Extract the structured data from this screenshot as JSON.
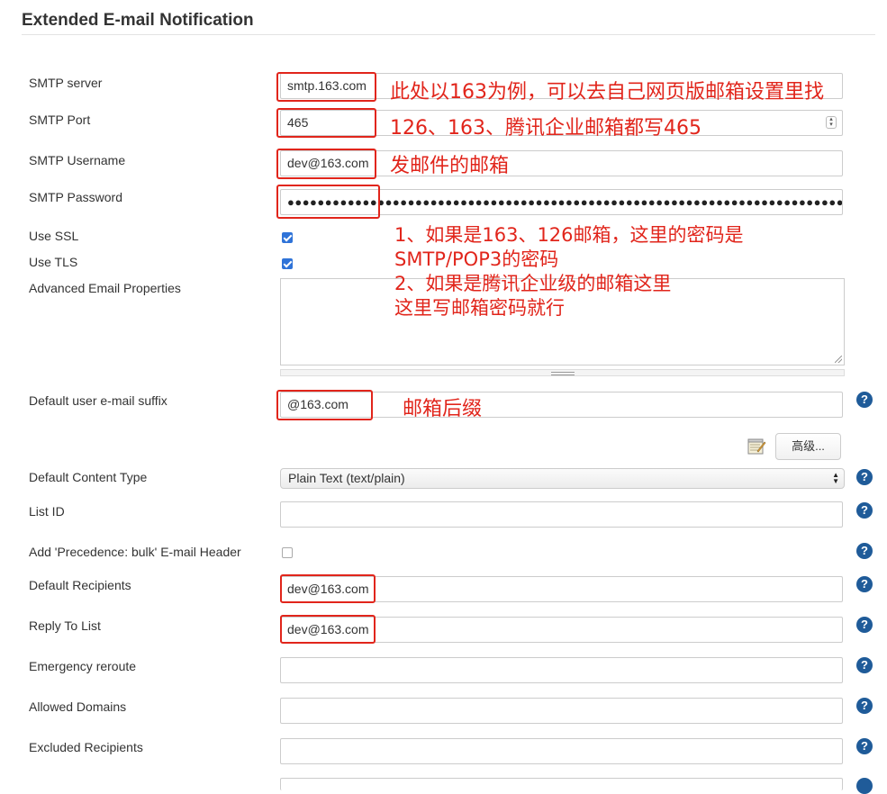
{
  "section": {
    "title": "Extended E-mail Notification"
  },
  "fields": {
    "smtp_server": {
      "label": "SMTP server",
      "value": "smtp.163.com"
    },
    "smtp_port": {
      "label": "SMTP Port",
      "value": "465"
    },
    "smtp_username": {
      "label": "SMTP Username",
      "value": "dev@163.com"
    },
    "smtp_password": {
      "label": "SMTP Password",
      "value": "●●●●●●●●●●●●●●●●●●●●●●●●●●●●●●●●●●●●●●●●●●●●●●●●●●●●●●●●●●●●●●●●●●●●●●●●●●●●●●●●●"
    },
    "use_ssl": {
      "label": "Use SSL",
      "checked": true
    },
    "use_tls": {
      "label": "Use TLS",
      "checked": true
    },
    "advanced_email_properties": {
      "label": "Advanced Email Properties",
      "value": ""
    },
    "default_user_suffix": {
      "label": "Default user e-mail suffix",
      "value": "@163.com"
    },
    "default_content_type": {
      "label": "Default Content Type",
      "value": "Plain Text (text/plain)"
    },
    "list_id": {
      "label": "List ID",
      "value": ""
    },
    "precedence_bulk": {
      "label": "Add 'Precedence: bulk' E-mail Header",
      "checked": false
    },
    "default_recipients": {
      "label": "Default Recipients",
      "value": "dev@163.com"
    },
    "reply_to_list": {
      "label": "Reply To List",
      "value": "dev@163.com"
    },
    "emergency_reroute": {
      "label": "Emergency reroute",
      "value": ""
    },
    "allowed_domains": {
      "label": "Allowed Domains",
      "value": ""
    },
    "excluded_recipients": {
      "label": "Excluded Recipients",
      "value": ""
    }
  },
  "advanced_button": {
    "label": "高级..."
  },
  "help_icon": {
    "glyph": "?"
  },
  "annotations": {
    "smtp_server": "此处以163为例，可以去自己网页版邮箱设置里找",
    "smtp_port": "126、163、腾讯企业邮箱都写465",
    "smtp_username": "发邮件的邮箱",
    "password_line1": "1、如果是163、126邮箱，这里的密码是",
    "password_line2": "SMTP/POP3的密码",
    "password_line3": "2、如果是腾讯企业级的邮箱这里",
    "password_line4": "这里写邮箱密码就行",
    "suffix": "邮箱后缀"
  },
  "colors": {
    "annotation": "#e1251b",
    "help": "#1f5b99",
    "checkbox": "#2f73d8"
  }
}
